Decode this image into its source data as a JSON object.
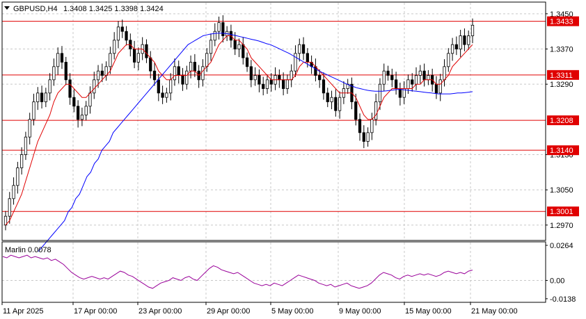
{
  "chart_data": [
    {
      "type": "candlestick",
      "symbol": "GBPUSD,H4",
      "ohlc_header": "1.3408 1.3425 1.3398 1.3424",
      "ylim": [
        1.2935,
        1.3475
      ],
      "yticks": [
        "1.3450",
        "1.3370",
        "1.3290",
        "1.3130",
        "1.3050",
        "1.2970"
      ],
      "xticks": [
        "11 Apr 2025",
        "17 Apr 00:00",
        "23 Apr 00:00",
        "29 Apr 00:00",
        "5 May 00:00",
        "9 May 00:00",
        "15 May 00:00",
        "21 May 00:00"
      ],
      "levels": [
        {
          "value": 1.3433,
          "label": "1.3433"
        },
        {
          "value": 1.3311,
          "label": "1.3311"
        },
        {
          "value": 1.3208,
          "label": "1.3208"
        },
        {
          "value": 1.314,
          "label": "1.3140"
        },
        {
          "value": 1.3001,
          "label": "1.3001"
        }
      ],
      "close_series": [
        1.299,
        1.303,
        1.306,
        1.31,
        1.313,
        1.317,
        1.321,
        1.325,
        1.327,
        1.325,
        1.327,
        1.33,
        1.333,
        1.336,
        1.334,
        1.33,
        1.326,
        1.324,
        1.321,
        1.322,
        1.324,
        1.327,
        1.33,
        1.332,
        1.331,
        1.333,
        1.336,
        1.339,
        1.342,
        1.341,
        1.339,
        1.337,
        1.334,
        1.336,
        1.338,
        1.335,
        1.332,
        1.33,
        1.327,
        1.326,
        1.327,
        1.33,
        1.333,
        1.331,
        1.329,
        1.332,
        1.334,
        1.332,
        1.33,
        1.333,
        1.336,
        1.339,
        1.341,
        1.343,
        1.34,
        1.341,
        1.339,
        1.337,
        1.338,
        1.335,
        1.333,
        1.33,
        1.331,
        1.329,
        1.328,
        1.33,
        1.329,
        1.331,
        1.33,
        1.328,
        1.33,
        1.332,
        1.336,
        1.338,
        1.336,
        1.334,
        1.333,
        1.331,
        1.33,
        1.327,
        1.325,
        1.326,
        1.323,
        1.326,
        1.328,
        1.329,
        1.325,
        1.321,
        1.318,
        1.316,
        1.318,
        1.321,
        1.325,
        1.329,
        1.332,
        1.331,
        1.33,
        1.328,
        1.326,
        1.328,
        1.33,
        1.329,
        1.331,
        1.332,
        1.33,
        1.331,
        1.329,
        1.327,
        1.33,
        1.333,
        1.336,
        1.338,
        1.337,
        1.34,
        1.338,
        1.34,
        1.3424
      ],
      "ma_fast": [
        1.297,
        1.298,
        1.3,
        1.302,
        1.304,
        1.307,
        1.31,
        1.313,
        1.316,
        1.318,
        1.32,
        1.322,
        1.325,
        1.327,
        1.328,
        1.329,
        1.329,
        1.328,
        1.327,
        1.326,
        1.326,
        1.327,
        1.328,
        1.329,
        1.33,
        1.331,
        1.332,
        1.334,
        1.336,
        1.337,
        1.338,
        1.338,
        1.337,
        1.337,
        1.337,
        1.336,
        1.335,
        1.334,
        1.332,
        1.331,
        1.33,
        1.33,
        1.331,
        1.331,
        1.331,
        1.331,
        1.332,
        1.332,
        1.331,
        1.332,
        1.333,
        1.334,
        1.336,
        1.338,
        1.339,
        1.34,
        1.34,
        1.339,
        1.339,
        1.338,
        1.337,
        1.335,
        1.334,
        1.333,
        1.332,
        1.331,
        1.33,
        1.33,
        1.33,
        1.33,
        1.33,
        1.33,
        1.331,
        1.333,
        1.334,
        1.334,
        1.334,
        1.333,
        1.332,
        1.331,
        1.33,
        1.329,
        1.328,
        1.327,
        1.327,
        1.327,
        1.327,
        1.326,
        1.324,
        1.322,
        1.321,
        1.321,
        1.322,
        1.324,
        1.326,
        1.327,
        1.328,
        1.328,
        1.328,
        1.328,
        1.328,
        1.328,
        1.329,
        1.329,
        1.33,
        1.33,
        1.33,
        1.329,
        1.329,
        1.33,
        1.331,
        1.333,
        1.334,
        1.335,
        1.336,
        1.337,
        1.338
      ],
      "ma_slow": [
        1.291,
        1.292,
        1.293,
        1.294,
        1.295,
        1.296,
        1.297,
        1.298,
        1.3,
        1.301,
        1.303,
        1.304,
        1.306,
        1.308,
        1.309,
        1.311,
        1.312,
        1.314,
        1.315,
        1.316,
        1.318,
        1.319,
        1.32,
        1.321,
        1.322,
        1.323,
        1.324,
        1.325,
        1.326,
        1.327,
        1.328,
        1.329,
        1.33,
        1.331,
        1.332,
        1.333,
        1.334,
        1.335,
        1.336,
        1.337,
        1.338,
        1.3385,
        1.339,
        1.3395,
        1.34,
        1.3402,
        1.3404,
        1.3405,
        1.3406,
        1.3406,
        1.3405,
        1.3404,
        1.3402,
        1.34,
        1.3398,
        1.3396,
        1.3394,
        1.3392,
        1.339,
        1.3388,
        1.3385,
        1.3382,
        1.338,
        1.3376,
        1.3372,
        1.3368,
        1.3364,
        1.336,
        1.3355,
        1.335,
        1.3345,
        1.334,
        1.3335,
        1.333,
        1.3325,
        1.332,
        1.3316,
        1.3312,
        1.3308,
        1.3304,
        1.33,
        1.3296,
        1.3292,
        1.3288,
        1.3285,
        1.3282,
        1.328,
        1.3278,
        1.3276,
        1.3275,
        1.3274,
        1.3274,
        1.3274,
        1.3275,
        1.3276,
        1.3277,
        1.3278,
        1.3278,
        1.3277,
        1.3276,
        1.3275,
        1.3274,
        1.3273,
        1.3272,
        1.3271,
        1.327,
        1.3269,
        1.3268,
        1.3268,
        1.3268,
        1.3268,
        1.3269,
        1.327,
        1.327,
        1.3271,
        1.3272,
        1.3273
      ]
    },
    {
      "type": "line",
      "name": "Marlin 0.0078",
      "ylim": [
        -0.0165,
        0.0285
      ],
      "yticks": [
        "0.0264",
        "0.00",
        "-0.0138"
      ],
      "values": [
        0.018,
        0.017,
        0.019,
        0.018,
        0.017,
        0.018,
        0.019,
        0.017,
        0.018,
        0.017,
        0.016,
        0.017,
        0.015,
        0.016,
        0.014,
        0.012,
        0.009,
        0.006,
        0.004,
        0.002,
        0.001,
        0.002,
        0.003,
        0.002,
        0.001,
        0.002,
        0.001,
        0.003,
        0.005,
        0.007,
        0.006,
        0.004,
        0.003,
        0.001,
        -0.001,
        -0.003,
        -0.005,
        -0.006,
        -0.004,
        -0.002,
        -0.001,
        0.0,
        0.002,
        0.001,
        0.0,
        0.002,
        0.003,
        0.001,
        0.0,
        0.003,
        0.006,
        0.009,
        0.011,
        0.01,
        0.008,
        0.007,
        0.006,
        0.005,
        0.006,
        0.004,
        0.002,
        0.0,
        -0.002,
        -0.003,
        -0.004,
        -0.003,
        -0.004,
        -0.002,
        -0.003,
        -0.004,
        -0.002,
        0.0,
        0.002,
        0.004,
        0.003,
        0.002,
        0.001,
        0.0,
        -0.002,
        -0.003,
        -0.004,
        -0.003,
        -0.005,
        -0.004,
        -0.003,
        -0.002,
        -0.004,
        -0.005,
        -0.006,
        -0.005,
        -0.004,
        -0.002,
        0.001,
        0.004,
        0.006,
        0.005,
        0.004,
        0.002,
        0.001,
        0.003,
        0.004,
        0.003,
        0.004,
        0.005,
        0.004,
        0.005,
        0.004,
        0.003,
        0.004,
        0.006,
        0.007,
        0.006,
        0.005,
        0.006,
        0.005,
        0.007,
        0.0078
      ]
    }
  ]
}
